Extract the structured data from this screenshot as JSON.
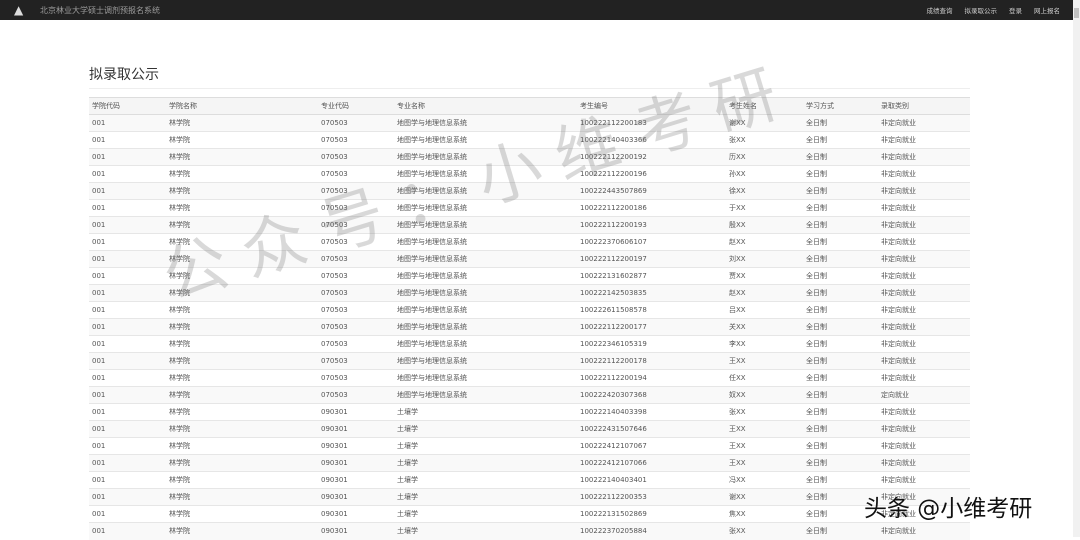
{
  "nav": {
    "brand": "北京林业大学硕士调剂预报名系统",
    "links": [
      "成绩查询",
      "拟录取公示",
      "登录",
      "网上报名"
    ]
  },
  "page_title": "拟录取公示",
  "table": {
    "headers": [
      "学院代码",
      "学院名称",
      "专业代码",
      "专业名称",
      "考生编号",
      "考生姓名",
      "学习方式",
      "录取类别"
    ],
    "rows": [
      [
        "001",
        "林学院",
        "070503",
        "地图学与地理信息系统",
        "100222112200183",
        "谢XX",
        "全日制",
        "非定向就业"
      ],
      [
        "001",
        "林学院",
        "070503",
        "地图学与地理信息系统",
        "100222140403366",
        "张XX",
        "全日制",
        "非定向就业"
      ],
      [
        "001",
        "林学院",
        "070503",
        "地图学与地理信息系统",
        "100222112200192",
        "历XX",
        "全日制",
        "非定向就业"
      ],
      [
        "001",
        "林学院",
        "070503",
        "地图学与地理信息系统",
        "100222112200196",
        "孙XX",
        "全日制",
        "非定向就业"
      ],
      [
        "001",
        "林学院",
        "070503",
        "地图学与地理信息系统",
        "100222443507869",
        "徐XX",
        "全日制",
        "非定向就业"
      ],
      [
        "001",
        "林学院",
        "070503",
        "地图学与地理信息系统",
        "100222112200186",
        "于XX",
        "全日制",
        "非定向就业"
      ],
      [
        "001",
        "林学院",
        "070503",
        "地图学与地理信息系统",
        "100222112200193",
        "殷XX",
        "全日制",
        "非定向就业"
      ],
      [
        "001",
        "林学院",
        "070503",
        "地图学与地理信息系统",
        "100222370606107",
        "赵XX",
        "全日制",
        "非定向就业"
      ],
      [
        "001",
        "林学院",
        "070503",
        "地图学与地理信息系统",
        "100222112200197",
        "刘XX",
        "全日制",
        "非定向就业"
      ],
      [
        "001",
        "林学院",
        "070503",
        "地图学与地理信息系统",
        "100222131602877",
        "贾XX",
        "全日制",
        "非定向就业"
      ],
      [
        "001",
        "林学院",
        "070503",
        "地图学与地理信息系统",
        "100222142503835",
        "赵XX",
        "全日制",
        "非定向就业"
      ],
      [
        "001",
        "林学院",
        "070503",
        "地图学与地理信息系统",
        "100222611508578",
        "吕XX",
        "全日制",
        "非定向就业"
      ],
      [
        "001",
        "林学院",
        "070503",
        "地图学与地理信息系统",
        "100222112200177",
        "关XX",
        "全日制",
        "非定向就业"
      ],
      [
        "001",
        "林学院",
        "070503",
        "地图学与地理信息系统",
        "100222346105319",
        "李XX",
        "全日制",
        "非定向就业"
      ],
      [
        "001",
        "林学院",
        "070503",
        "地图学与地理信息系统",
        "100222112200178",
        "王XX",
        "全日制",
        "非定向就业"
      ],
      [
        "001",
        "林学院",
        "070503",
        "地图学与地理信息系统",
        "100222112200194",
        "任XX",
        "全日制",
        "非定向就业"
      ],
      [
        "001",
        "林学院",
        "070503",
        "地图学与地理信息系统",
        "100222420307368",
        "奴XX",
        "全日制",
        "定向就业"
      ],
      [
        "001",
        "林学院",
        "090301",
        "土壤学",
        "100222140403398",
        "张XX",
        "全日制",
        "非定向就业"
      ],
      [
        "001",
        "林学院",
        "090301",
        "土壤学",
        "100222431507646",
        "王XX",
        "全日制",
        "非定向就业"
      ],
      [
        "001",
        "林学院",
        "090301",
        "土壤学",
        "100222412107067",
        "王XX",
        "全日制",
        "非定向就业"
      ],
      [
        "001",
        "林学院",
        "090301",
        "土壤学",
        "100222412107066",
        "王XX",
        "全日制",
        "非定向就业"
      ],
      [
        "001",
        "林学院",
        "090301",
        "土壤学",
        "100222140403401",
        "冯XX",
        "全日制",
        "非定向就业"
      ],
      [
        "001",
        "林学院",
        "090301",
        "土壤学",
        "100222112200353",
        "谢XX",
        "全日制",
        "非定向就业"
      ],
      [
        "001",
        "林学院",
        "090301",
        "土壤学",
        "100222131502869",
        "焦XX",
        "全日制",
        "非定向就业"
      ],
      [
        "001",
        "林学院",
        "090301",
        "土壤学",
        "100222370205884",
        "张XX",
        "全日制",
        "非定向就业"
      ]
    ]
  },
  "watermark": {
    "diagonal": "公众号：小维考研",
    "corner": "头条 @小维考研"
  }
}
